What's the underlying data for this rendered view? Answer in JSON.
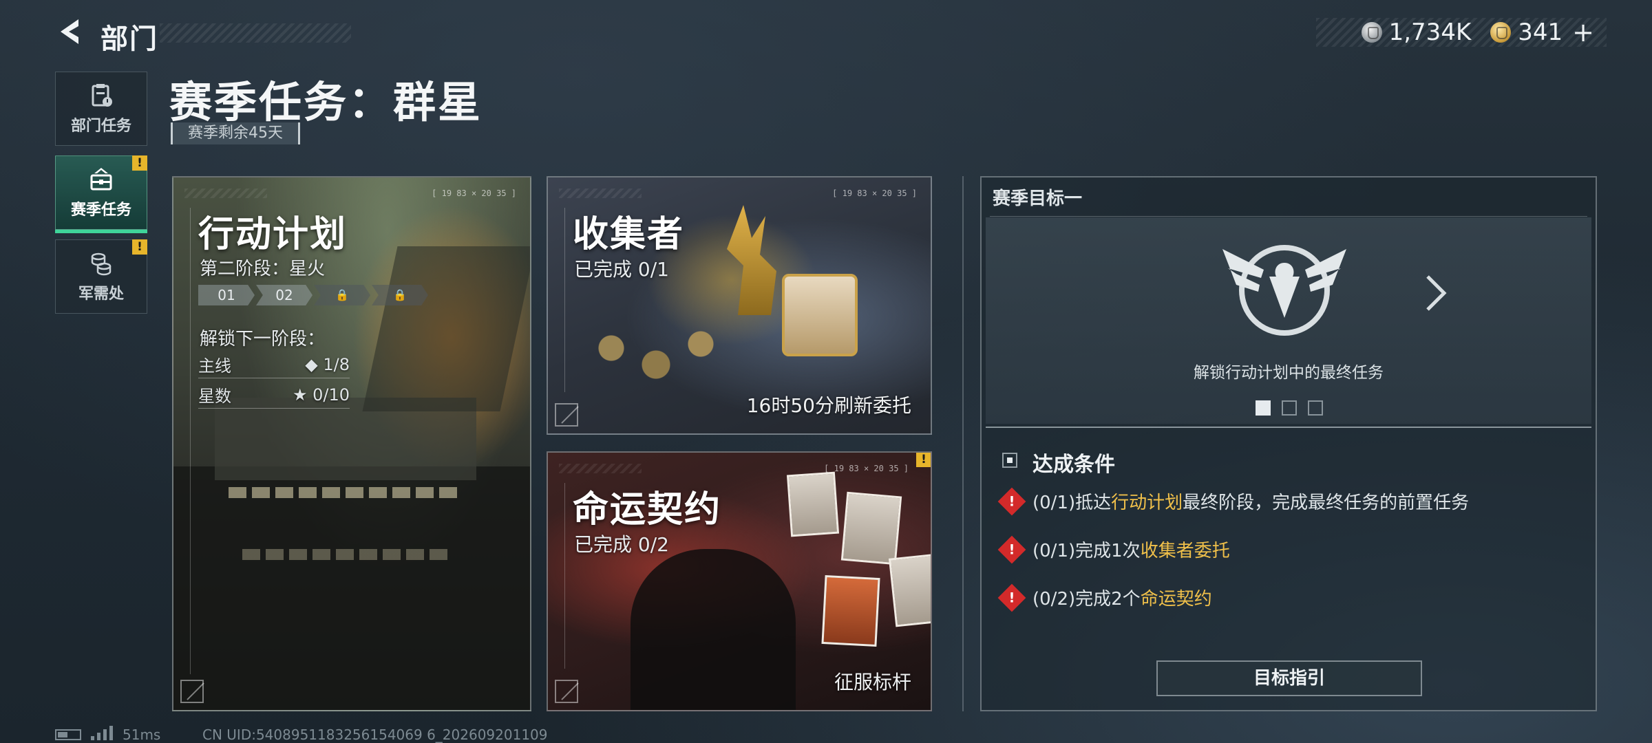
{
  "header": {
    "title": "部门",
    "currencies": [
      {
        "icon": "silver-coin-icon",
        "value": "1,734K"
      },
      {
        "icon": "gold-coin-icon",
        "value": "341"
      }
    ],
    "add_label": "+"
  },
  "sidebar": {
    "items": [
      {
        "label": "部门任务",
        "icon": "clipboard-icon",
        "active": false,
        "alert": false
      },
      {
        "label": "赛季任务",
        "icon": "briefcase-icon",
        "active": true,
        "alert": true
      },
      {
        "label": "军需处",
        "icon": "coins-stack-icon",
        "active": false,
        "alert": true
      }
    ],
    "alert_mark": "!"
  },
  "page": {
    "title": "赛季任务：群星",
    "season_remaining": "赛季剩余45天"
  },
  "cards": {
    "coords": "[ 19 83 × 20 35 ]",
    "plan": {
      "title": "行动计划",
      "stage_label": "第二阶段：星火",
      "stages": [
        "01",
        "02",
        "🔒",
        "🔒"
      ],
      "unlock_label": "解锁下一阶段：",
      "requirements": [
        {
          "label": "主线",
          "value": "◆ 1/8"
        },
        {
          "label": "星数",
          "value": "★ 0/10"
        }
      ]
    },
    "collector": {
      "title": "收集者",
      "progress": "已完成 0/1",
      "footer": "16时50分刷新委托"
    },
    "fate": {
      "title": "命运契约",
      "progress": "已完成 0/2",
      "footer": "征服标杆",
      "alert": "!"
    }
  },
  "goal": {
    "header": "赛季目标一",
    "emblem_icon": "eagle-emblem-icon",
    "description": "解锁行动计划中的最终任务",
    "page_count": 3,
    "current_page": 1,
    "conditions_title": "达成条件",
    "conditions": [
      {
        "prefix": "(0/1)抵达",
        "highlight": "行动计划",
        "suffix": "最终阶段，完成最终任务的前置任务"
      },
      {
        "prefix": "(0/1)完成1次",
        "highlight": "收集者委托",
        "suffix": ""
      },
      {
        "prefix": "(0/2)完成2个",
        "highlight": "命运契约",
        "suffix": ""
      }
    ],
    "guide_button": "目标指引"
  },
  "footer": {
    "ping": "51ms",
    "uid": "CN UID:5408951183256154069 6_202609201109"
  },
  "colors": {
    "accent_green": "#3fd49a",
    "highlight_gold": "#f0c04a",
    "warning_red": "#d32a2a",
    "alert_yellow": "#e7b52b"
  }
}
